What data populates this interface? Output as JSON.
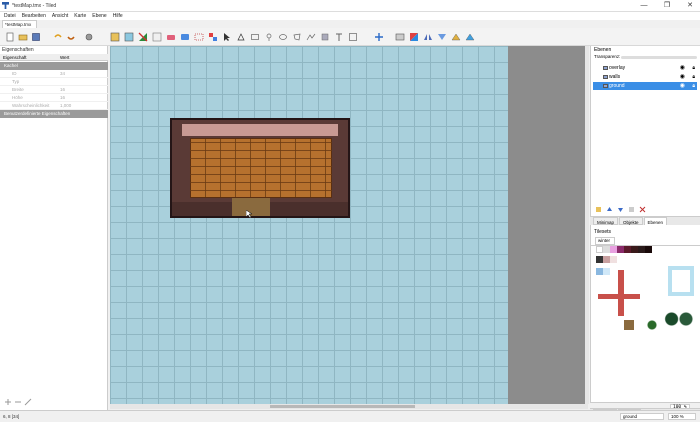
{
  "window": {
    "title": "*testMap.tmx - Tiled",
    "min_label": "—",
    "max_label": "❐",
    "close_label": "✕"
  },
  "menu": [
    "Datei",
    "Bearbeiten",
    "Ansicht",
    "Karte",
    "Ebene",
    "Hilfe"
  ],
  "document_tab": {
    "label": "*testMap.tmx",
    "close": "×"
  },
  "properties": {
    "title": "Eigenschaften",
    "col_name": "Eigenschaft",
    "col_value": "Wert",
    "section1": "Kachel",
    "rows": [
      {
        "key": "ID",
        "value": "34"
      },
      {
        "key": "Typ",
        "value": ""
      },
      {
        "key": "Breite",
        "value": "16"
      },
      {
        "key": "Höhe",
        "value": "16"
      },
      {
        "key": "Wahrscheinlichkeit",
        "value": "1,000"
      }
    ],
    "section2": "Benutzerdefinierte Eigenschaften"
  },
  "layers": {
    "title": "Ebenen",
    "opacity_label": "Transparenz:",
    "items": [
      {
        "name": "overlay",
        "selected": false
      },
      {
        "name": "walls",
        "selected": false
      },
      {
        "name": "ground",
        "selected": true
      }
    ],
    "tabs": [
      "Minimap",
      "Objekte",
      "Ebenen"
    ],
    "active_tab": "Ebenen"
  },
  "tilesets": {
    "title": "Tilesets",
    "current": "winter",
    "zoom": "100 %",
    "tabs": [
      "Terrains",
      "Tilesets"
    ],
    "active_tab": "Tilesets"
  },
  "status": {
    "coords": "6, 8 [34]",
    "layer_select": "ground",
    "zoom": "100 %"
  },
  "colors": {
    "canvas_bg": "#a9d0dc",
    "grid": "#8fb6c2",
    "selection": "#3a8ee6",
    "pad_gray": "#8c8c8c"
  }
}
